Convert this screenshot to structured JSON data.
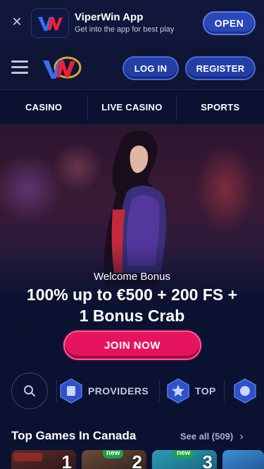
{
  "app_banner": {
    "close_icon": "close-icon",
    "app_name": "ViperWin App",
    "tagline": "Get into the app for best play",
    "open_label": "OPEN"
  },
  "header": {
    "menu_icon": "hamburger-icon",
    "logo_text": "VW",
    "login_label": "LOG IN",
    "register_label": "REGISTER"
  },
  "nav": {
    "items": [
      {
        "label": "CASINO"
      },
      {
        "label": "LIVE CASINO"
      },
      {
        "label": "SPORTS"
      }
    ]
  },
  "hero": {
    "subtitle": "Welcome Bonus",
    "title_line1": "100% up to €500 + 200 FS +",
    "title_line2": "1 Bonus Crab",
    "cta_label": "JOIN NOW"
  },
  "categories": {
    "search_icon": "search-icon",
    "items": [
      {
        "label": "PROVIDERS",
        "icon": "providers-icon"
      },
      {
        "label": "TOP",
        "icon": "star-icon"
      }
    ]
  },
  "top_games": {
    "title": "Top Games In Canada",
    "see_all": "See all (509)",
    "tiles": [
      {
        "rank": "1",
        "new": ""
      },
      {
        "rank": "2",
        "new": "new"
      },
      {
        "rank": "3",
        "new": "new"
      }
    ]
  },
  "colors": {
    "background": "#0b1130",
    "accent_blue": "#233fa5",
    "cta_pink": "#e6145f",
    "new_badge": "#1ca14c"
  }
}
